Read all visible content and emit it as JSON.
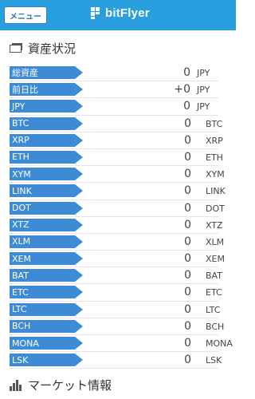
{
  "header": {
    "menu_label": "メニュー",
    "logo_text": "bitFlyer",
    "accent": "#2a9fe0"
  },
  "assets": {
    "title": "資産状況",
    "rows": [
      {
        "label": "総資産",
        "amount": "0",
        "unit": "JPY"
      },
      {
        "label": "前日比",
        "amount": "+0",
        "unit": "JPY"
      },
      {
        "label": "JPY",
        "amount": "0",
        "unit": "JPY"
      },
      {
        "label": "BTC",
        "amount": "0",
        "unit": "BTC"
      },
      {
        "label": "XRP",
        "amount": "0",
        "unit": "XRP"
      },
      {
        "label": "ETH",
        "amount": "0",
        "unit": "ETH"
      },
      {
        "label": "XYM",
        "amount": "0",
        "unit": "XYM"
      },
      {
        "label": "LINK",
        "amount": "0",
        "unit": "LINK"
      },
      {
        "label": "DOT",
        "amount": "0",
        "unit": "DOT"
      },
      {
        "label": "XTZ",
        "amount": "0",
        "unit": "XTZ"
      },
      {
        "label": "XLM",
        "amount": "0",
        "unit": "XLM"
      },
      {
        "label": "XEM",
        "amount": "0",
        "unit": "XEM"
      },
      {
        "label": "BAT",
        "amount": "0",
        "unit": "BAT"
      },
      {
        "label": "ETC",
        "amount": "0",
        "unit": "ETC"
      },
      {
        "label": "LTC",
        "amount": "0",
        "unit": "LTC"
      },
      {
        "label": "BCH",
        "amount": "0",
        "unit": "BCH"
      },
      {
        "label": "MONA",
        "amount": "0",
        "unit": "MONA"
      },
      {
        "label": "LSK",
        "amount": "0",
        "unit": "LSK"
      }
    ]
  },
  "market": {
    "title": "マーケット情報"
  },
  "icons": {
    "wallet": "wallet-icon",
    "chart": "bar-chart-icon",
    "logo": "bitflyer-logo-icon"
  },
  "colors": {
    "label_bg": "#3d8ad5",
    "header_bg": "#2a9fe0"
  }
}
